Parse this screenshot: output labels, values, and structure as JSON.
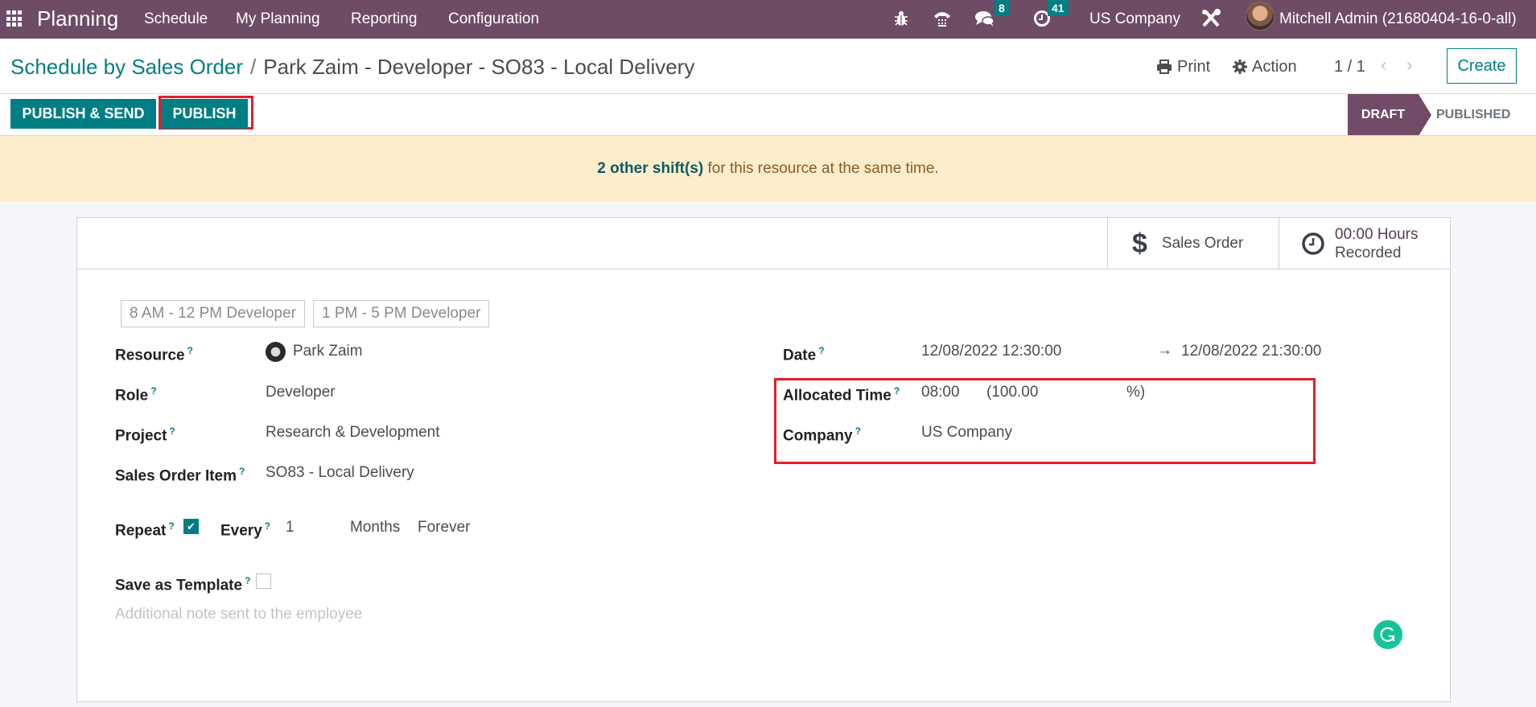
{
  "navbar": {
    "app_name": "Planning",
    "menus": [
      "Schedule",
      "My Planning",
      "Reporting",
      "Configuration"
    ],
    "icons": [
      "apps-grid-icon",
      "bug-icon",
      "phone-icon",
      "chat-icon",
      "activity-clock-icon",
      "tools-icon"
    ],
    "messages_badge": "8",
    "activities_badge": "41",
    "company": "US Company",
    "user": "Mitchell Admin (21680404-16-0-all)"
  },
  "control_panel": {
    "breadcrumb_parent": "Schedule by Sales Order",
    "breadcrumb_separator": "/",
    "breadcrumb_current": "Park Zaim - Developer - SO83 - Local Delivery",
    "print_label": "Print",
    "action_label": "Action",
    "pager": "1 / 1",
    "create_label": "Create"
  },
  "header_buttons": {
    "publish_send": "PUBLISH & SEND",
    "publish": "PUBLISH"
  },
  "statusbar": {
    "states": [
      "DRAFT",
      "PUBLISHED"
    ],
    "active": "DRAFT"
  },
  "banner": {
    "link_text": "2 other shift(s)",
    "text": " for this resource at the same time."
  },
  "stat_buttons": {
    "sales_order": "Sales Order",
    "hours_value": "00:00 Hours",
    "hours_label": "Recorded"
  },
  "templates": [
    "8 AM - 12 PM Developer",
    "1 PM - 5 PM Developer"
  ],
  "fields_left": {
    "resource_label": "Resource",
    "resource_value": "Park Zaim",
    "role_label": "Role",
    "role_value": "Developer",
    "project_label": "Project",
    "project_value": "Research & Development",
    "soi_label": "Sales Order Item",
    "soi_value": "SO83 - Local Delivery",
    "repeat_label": "Repeat",
    "repeat_checked": true,
    "every_label": "Every",
    "every_value": "1",
    "every_unit": "Months",
    "repeat_type": "Forever",
    "template_label": "Save as Template",
    "template_checked": false,
    "note_placeholder": "Additional note sent to the employee"
  },
  "fields_right": {
    "date_label": "Date",
    "date_start": "12/08/2022 12:30:00",
    "date_arrow": "→",
    "date_end": "12/08/2022 21:30:00",
    "allocated_label": "Allocated Time",
    "allocated_hours": "08:00",
    "allocated_pct_open": "(100.00",
    "allocated_pct_close": "%)",
    "company_label": "Company",
    "company_value": "US Company"
  },
  "help_marker": "?",
  "colors": {
    "navbar": "#6e4c66",
    "primary": "#017e84",
    "status_active": "#714b67",
    "banner_bg": "#feedcb",
    "highlight_box": "#e31e2b",
    "grammarly": "#15c39a"
  }
}
